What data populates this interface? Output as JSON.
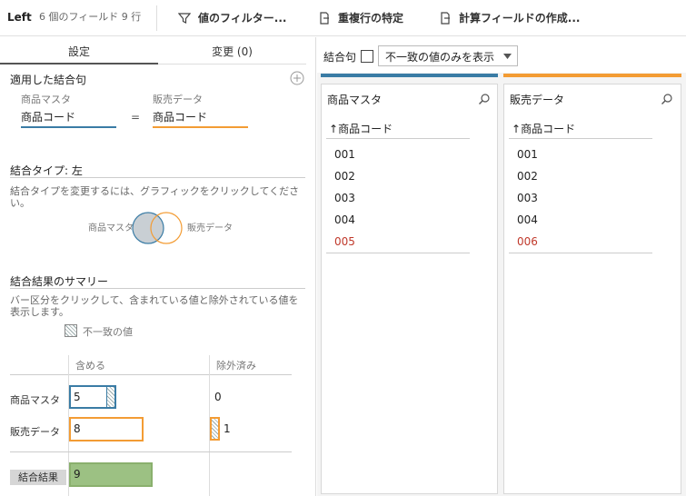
{
  "toolbar": {
    "title": "Left",
    "subtitle": "6 個のフィールド  9 行",
    "filter_label": "値のフィルター...",
    "duplicate_label": "重複行の特定",
    "calc_label": "計算フィールドの作成..."
  },
  "tabs": {
    "settings": "設定",
    "changes": "変更 (0)"
  },
  "join_clause": {
    "title": "適用した結合句",
    "left_source": "商品マスタ",
    "left_field": "商品コード",
    "operator": "=",
    "right_source": "販売データ",
    "right_field": "商品コード"
  },
  "join_type": {
    "title": "結合タイプ: 左",
    "hint": "結合タイプを変更するには、グラフィックをクリックしてください。",
    "venn_left": "商品マスタ",
    "venn_right": "販売データ"
  },
  "summary": {
    "title": "結合結果のサマリー",
    "hint": "バー区分をクリックして、含まれている値と除外されている値を表示します。",
    "legend": "不一致の値",
    "col_include": "含める",
    "col_exclude": "除外済み",
    "rows": [
      {
        "label": "商品マスタ",
        "included": "5",
        "excluded": "0"
      },
      {
        "label": "販売データ",
        "included": "8",
        "excluded": "1"
      }
    ],
    "result_label": "結合結果",
    "result_value": "9"
  },
  "right_bar": {
    "clause_label": "結合句",
    "dropdown_value": "不一致の値のみを表示"
  },
  "left_card": {
    "title": "商品マスタ",
    "column": "商品コード",
    "sort_icon": "↑",
    "rows": [
      "001",
      "002",
      "003",
      "004",
      "005"
    ]
  },
  "right_card": {
    "title": "販売データ",
    "column": "商品コード",
    "sort_icon": "↑",
    "rows": [
      "001",
      "002",
      "003",
      "004",
      "006"
    ]
  },
  "colors": {
    "left": "#3a7ca5",
    "right": "#f39c34",
    "result": "#9cc183",
    "mismatch": "#c0392b"
  }
}
